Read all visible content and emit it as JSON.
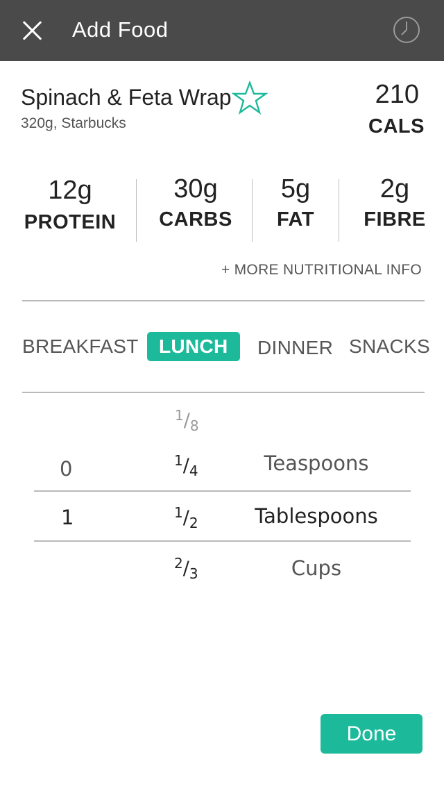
{
  "header": {
    "title": "Add Food",
    "close_icon": "close-icon",
    "history_icon": "clock-icon"
  },
  "food": {
    "name": "Spinach & Feta Wrap",
    "details": "320g, Starbucks",
    "calories": "210",
    "calories_unit": "CALS",
    "favorite_icon": "star-outline-icon"
  },
  "macros": [
    {
      "value": "12g",
      "label": "PROTEIN"
    },
    {
      "value": "30g",
      "label": "CARBS"
    },
    {
      "value": "5g",
      "label": "FAT"
    },
    {
      "value": "2g",
      "label": "FIBRE"
    }
  ],
  "more_info": "+ MORE NUTRITIONAL INFO",
  "meals": {
    "breakfast": "BREAKFAST",
    "lunch": "LUNCH",
    "dinner": "DINNER",
    "snacks": "SNACKS",
    "selected": "LUNCH"
  },
  "picker": {
    "whole": {
      "above": "0",
      "selected": "1"
    },
    "fractions": [
      {
        "num": "1",
        "den": "8"
      },
      {
        "num": "1",
        "den": "4"
      },
      {
        "num": "1",
        "den": "2"
      },
      {
        "num": "2",
        "den": "3"
      }
    ],
    "fraction_selected": "1/2",
    "units": {
      "above": "Teaspoons",
      "selected": "Tablespoons",
      "below": "Cups"
    }
  },
  "done_label": "Done",
  "colors": {
    "accent": "#1cb99a",
    "header_bg": "#4a4a4a"
  }
}
